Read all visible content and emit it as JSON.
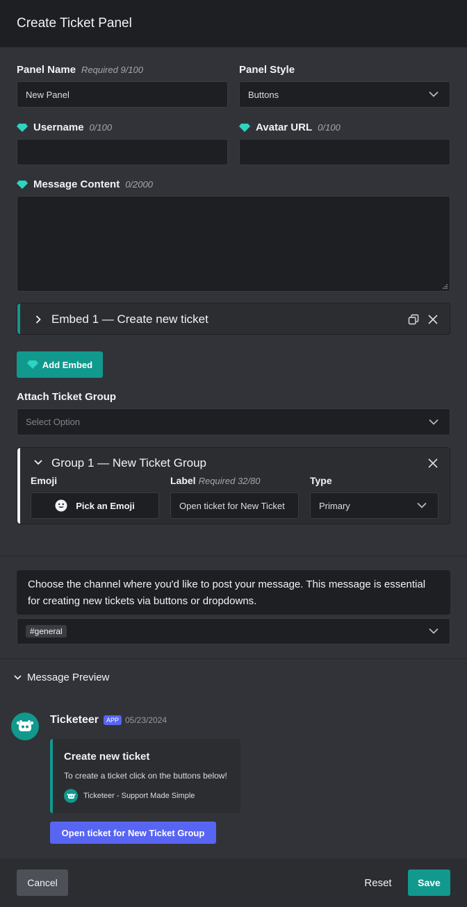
{
  "header": {
    "title": "Create Ticket Panel"
  },
  "panel_name": {
    "label": "Panel Name",
    "hint": "Required 9/100",
    "value": "New Panel"
  },
  "panel_style": {
    "label": "Panel Style",
    "value": "Buttons"
  },
  "username": {
    "label": "Username",
    "hint": "0/100",
    "value": ""
  },
  "avatar_url": {
    "label": "Avatar URL",
    "hint": "0/100",
    "value": ""
  },
  "message_content": {
    "label": "Message Content",
    "hint": "0/2000",
    "value": ""
  },
  "embed": {
    "title": "Embed 1 — Create new ticket",
    "accent": "#11998e"
  },
  "add_embed": {
    "label": "Add Embed"
  },
  "attach_group": {
    "label": "Attach Ticket Group",
    "placeholder": "Select Option"
  },
  "group": {
    "title": "Group 1 — New Ticket Group",
    "emoji_label": "Emoji",
    "emoji_button": "Pick an Emoji",
    "label_label": "Label",
    "label_hint": "Required 32/80",
    "label_value": "Open ticket for New Ticket",
    "type_label": "Type",
    "type_value": "Primary"
  },
  "channel": {
    "info": "Choose the channel where you'd like to post your message. This message is essential for creating new tickets via buttons or dropdowns.",
    "selected": "#general"
  },
  "preview": {
    "label": "Message Preview",
    "bot_name": "Ticketeer",
    "app_badge": "APP",
    "date": "05/23/2024",
    "embed_title": "Create new ticket",
    "embed_desc": "To create a ticket click on the buttons below!",
    "embed_footer": "Ticketeer - Support Made Simple",
    "button_label": "Open ticket for New Ticket Group"
  },
  "footer": {
    "cancel": "Cancel",
    "reset": "Reset",
    "save": "Save"
  },
  "colors": {
    "accent": "#11998e",
    "blurple": "#5865f2",
    "background": "#313338"
  }
}
